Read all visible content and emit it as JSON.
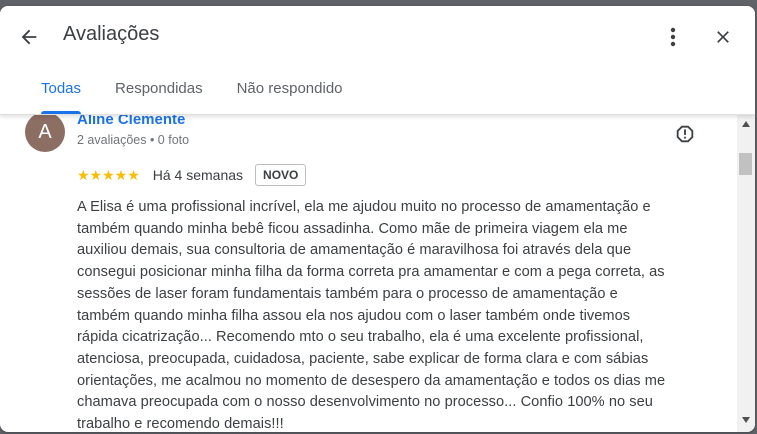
{
  "header": {
    "title": "Avaliações",
    "tabs": [
      {
        "label": "Todas",
        "active": true
      },
      {
        "label": "Respondidas",
        "active": false
      },
      {
        "label": "Não respondido",
        "active": false
      }
    ]
  },
  "review": {
    "avatar_letter": "A",
    "reviewer_name": "Aline Clemente",
    "meta": "2 avaliações • 0 foto",
    "stars": "★★★★★",
    "rating": 5,
    "time": "Há 4 semanas",
    "badge": "NOVO",
    "text_lines": [
      "A Elisa é uma profissional incrível, ela me ajudou muito no processo de amamentação e",
      "também quando minha bebê ficou assadinha. Como mãe de primeira viagem ela me",
      "auxiliou demais, sua consultoria de amamentação é maravilhosa foi através dela que",
      "consegui posicionar minha filha da forma correta pra amamentar e com a pega correta, as",
      "sessões de laser foram fundamentais também para o processo de amamentação e",
      "também quando minha filha assou ela nos ajudou com o laser também onde tivemos",
      "rápida cicatrização... Recomendo mto o seu trabalho, ela é uma excelente profissional,",
      "atenciosa, preocupada, cuidadosa, paciente, sabe explicar de forma clara e com sábias",
      "orientações, me acalmou no momento de desespero da amamentação e todos os dias me",
      "chamava preocupada com o nosso desenvolvimento no processo... Confio 100% no seu",
      "trabalho e recomendo demais!!!"
    ]
  },
  "colors": {
    "accent": "#1a73e8",
    "star": "#fbbc04",
    "avatar": "#8d6e63"
  },
  "icons": {
    "back": "arrow-left-icon",
    "more": "more-vert-icon",
    "close": "close-icon",
    "flag": "report-icon"
  }
}
